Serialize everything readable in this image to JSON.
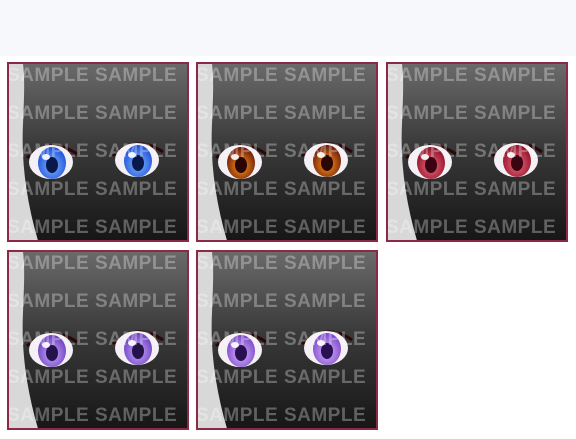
{
  "watermark_text": "SAMPLE SAMPLE",
  "border_color": "#8a2a45",
  "tiles": [
    {
      "name": "blue",
      "iris": "#1d4fd8",
      "iris_light": "#7fb4ff",
      "pupil": "#08184a"
    },
    {
      "name": "amber",
      "iris": "#6b1608",
      "iris_light": "#ff9a1a",
      "pupil": "#2a0605"
    },
    {
      "name": "crimson",
      "iris": "#8d0f22",
      "iris_light": "#f06a86",
      "pupil": "#3a0410"
    },
    {
      "name": "violet",
      "iris": "#6a3fbd",
      "iris_light": "#c9a8ff",
      "pupil": "#24124a"
    },
    {
      "name": "violet-lash",
      "iris": "#7a46c8",
      "iris_light": "#d6b3ff",
      "pupil": "#2a1050"
    }
  ]
}
